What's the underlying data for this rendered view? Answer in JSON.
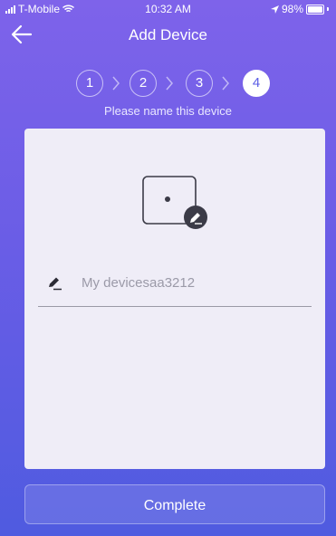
{
  "status_bar": {
    "carrier": "T-Mobile",
    "time": "10:32 AM",
    "battery": "98%"
  },
  "nav": {
    "title": "Add Device",
    "back_icon": "back-arrow-icon"
  },
  "steps": [
    {
      "label": "1",
      "active": false
    },
    {
      "label": "2",
      "active": false
    },
    {
      "label": "3",
      "active": false
    },
    {
      "label": "4",
      "active": true
    }
  ],
  "subtitle": "Please name this device",
  "form": {
    "device_icon": "device-edit-icon",
    "name_value": "My devicesaa3212",
    "field_icon": "pen-icon"
  },
  "complete_label": "Complete",
  "colors": {
    "bg_top": "#7e63ea",
    "bg_bottom": "#4f5be0",
    "active_step_text": "#5a5de5",
    "card_bg": "#efedf7"
  }
}
